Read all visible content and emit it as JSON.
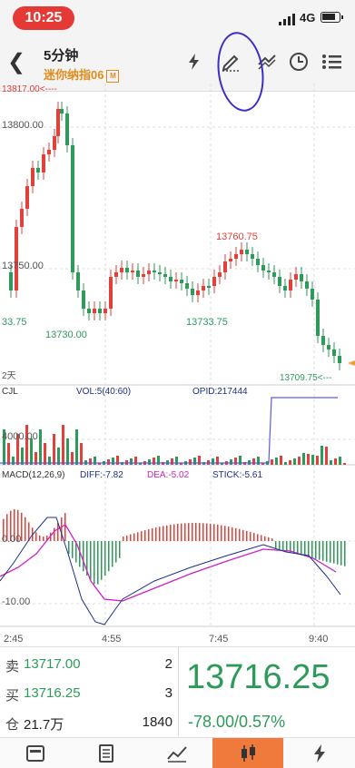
{
  "status": {
    "time": "10:25",
    "network": "4G"
  },
  "header": {
    "title": "5分钟",
    "subtitle": "迷你纳指06",
    "badge": "M"
  },
  "price_chart": {
    "top_left_label": "13817.00<----",
    "level_13800": "13800.00",
    "level_13750": "13750.00",
    "left_clip": "33.75",
    "low_label_1": "13730.00",
    "mid_label": "13733.75",
    "high_label": "13760.75",
    "low_label_2": "13709.75<---",
    "period": "2天"
  },
  "volume": {
    "title": "CJL",
    "vol_label": "VOL:5(40:60)",
    "opid_label": "OPID:217444",
    "level": "4000.00"
  },
  "macd": {
    "title": "MACD(12,26,9)",
    "diff": "DIFF:-7.82",
    "dea": "DEA:-5.02",
    "stick": "STICK:-5.61",
    "zero": "0.00",
    "neg": "-10.00"
  },
  "time_axis": [
    "2:45",
    "4:55",
    "7:45",
    "9:40"
  ],
  "quote": {
    "sell_label": "卖",
    "sell_price": "13717.00",
    "sell_qty": "2",
    "buy_label": "买",
    "buy_price": "13716.25",
    "buy_qty": "3",
    "oi_label": "仓",
    "oi_value": "21.7万",
    "oi_qty": "1840",
    "last": "13716.25",
    "change": "-78.00/0.57%"
  },
  "colors": {
    "up": "#e0413a",
    "down": "#2e9a5a",
    "accent": "#f07a3c",
    "dea": "#d01fc0",
    "diff": "#1b2f8a"
  },
  "icons": [
    "back-icon",
    "lightning-icon",
    "pen-icon",
    "draw-lines-icon",
    "clock-icon",
    "list-menu-icon",
    "list-tab-icon",
    "page-tab-icon",
    "trend-tab-icon",
    "candle-tab-icon",
    "lightning-tab-icon"
  ]
}
